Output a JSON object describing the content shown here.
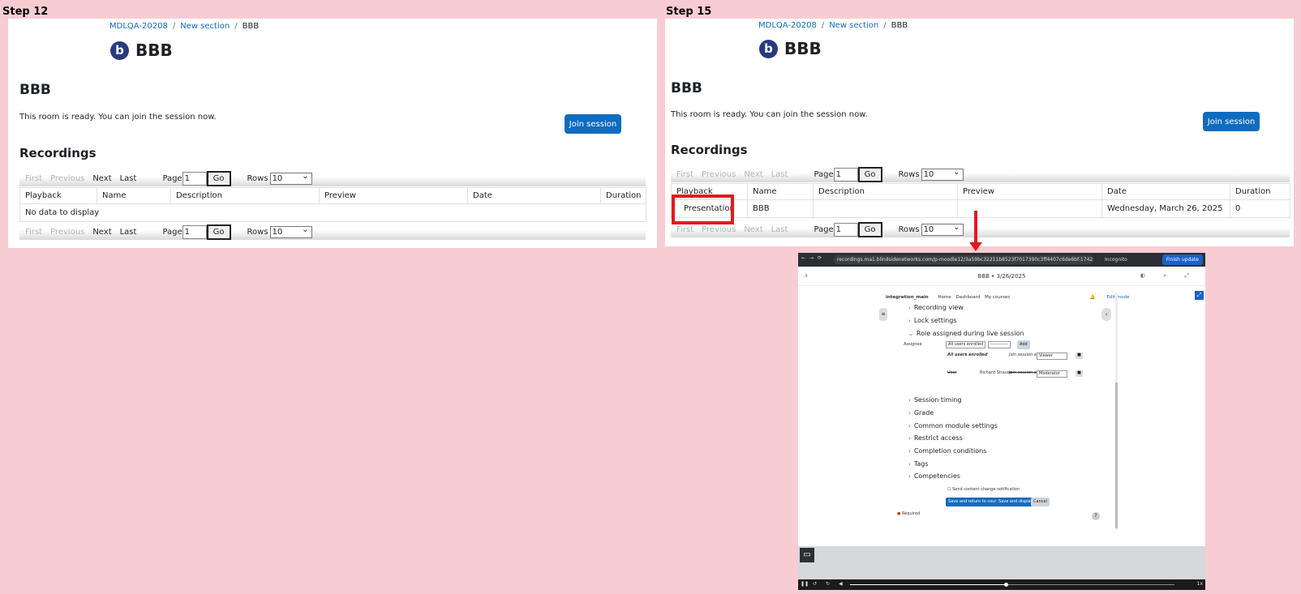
{
  "steps": [
    {
      "label": "Step 12",
      "breadcrumb": [
        "MDLQA-20208",
        "New section",
        "BBB"
      ],
      "logo_text": "BBB",
      "heading": "BBB",
      "ready_text": "This room is ready. You can join the session now.",
      "join_label": "Join session",
      "recordings_heading": "Recordings",
      "pager": {
        "first": "First",
        "previous": "Previous",
        "next": "Next",
        "last": "Last",
        "page_label": "Page",
        "page_value": "1",
        "go": "Go",
        "rows_label": "Rows",
        "rows_value": "10"
      },
      "columns": [
        "Playback",
        "Name",
        "Description",
        "Preview",
        "Date",
        "Duration"
      ],
      "empty_text": "No data to display"
    },
    {
      "label": "Step 15",
      "breadcrumb": [
        "MDLQA-20208",
        "New section",
        "BBB"
      ],
      "logo_text": "BBB",
      "heading": "BBB",
      "ready_text": "This room is ready. You can join the session now.",
      "join_label": "Join session",
      "recordings_heading": "Recordings",
      "pager": {
        "first": "First",
        "previous": "Previous",
        "next": "Next",
        "last": "Last",
        "page_label": "Page",
        "page_value": "1",
        "go": "Go",
        "rows_label": "Rows",
        "rows_value": "10"
      },
      "columns": [
        "Playback",
        "Name",
        "Description",
        "Preview",
        "Date",
        "Duration"
      ],
      "row": {
        "playback": "Presentation",
        "name": "BBB",
        "description": "",
        "preview": "",
        "date": "Wednesday, March 26, 2025",
        "duration": "0"
      }
    }
  ],
  "annotation_color": "#e8171c",
  "playback_window": {
    "url": "recordings.ma1.blindsidenetworks.com/p-moodle12/3a59bc32211b8523f7017390c3ff4407c6de6bf-1742988186...",
    "incognito": "Incognito",
    "finish_update": "Finish update",
    "title": "BBB • 3/26/2025",
    "site_name": "integration_main",
    "nav": [
      "Home",
      "Dashboard",
      "My courses"
    ],
    "edit_mode": "Edit mode",
    "sections": [
      "Recording view",
      "Lock settings",
      "Role assigned during live session",
      "Session timing",
      "Grade",
      "Common module settings",
      "Restrict access",
      "Completion conditions",
      "Tags",
      "Competencies"
    ],
    "assignee_label": "Assignee",
    "assignee_select": "All users enrolled",
    "assignee_select2": "------------",
    "add_label": "Add",
    "role_rows": [
      {
        "who": "All users enrolled",
        "join": "Join session as",
        "role": "Viewer"
      },
      {
        "who": "User",
        "name": "Richard Strauss",
        "join": "Join session as",
        "role": "Moderator"
      }
    ],
    "notify_label": "Send content change notification",
    "buttons": [
      "Save and return to course",
      "Save and display",
      "Cancel"
    ],
    "required_label": "Required",
    "speed": "1x"
  }
}
